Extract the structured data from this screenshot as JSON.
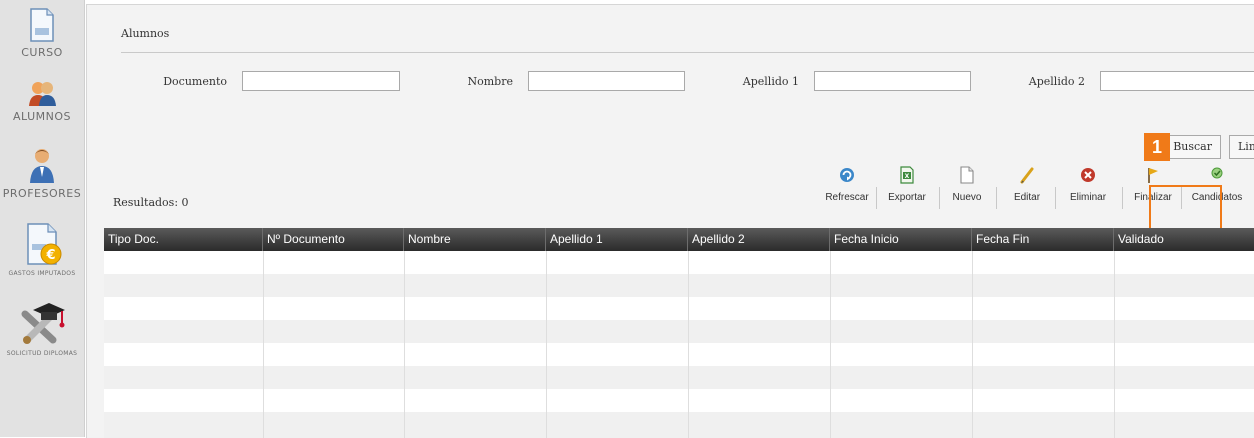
{
  "sidebar": {
    "items": [
      {
        "label": "CURSO",
        "icon": "document-icon"
      },
      {
        "label": "ALUMNOS",
        "icon": "students-icon"
      },
      {
        "label": "PROFESORES",
        "icon": "teacher-icon"
      },
      {
        "label": "GASTOS IMPUTADOS",
        "icon": "euro-document-icon"
      },
      {
        "label": "SOLICITUD DIPLOMAS",
        "icon": "diploma-icon"
      }
    ]
  },
  "section": {
    "title": "Alumnos"
  },
  "filters": {
    "documento": {
      "label": "Documento",
      "value": ""
    },
    "nombre": {
      "label": "Nombre",
      "value": ""
    },
    "apellido1": {
      "label": "Apellido 1",
      "value": ""
    },
    "apellido2": {
      "label": "Apellido 2",
      "value": ""
    }
  },
  "search_buttons": {
    "buscar": "Buscar",
    "limpiar": "Limpiar"
  },
  "step_badge": "1",
  "results": {
    "label": "Resultados: 0"
  },
  "toolbar": {
    "refrescar": "Refrescar",
    "exportar": "Exportar",
    "nuevo": "Nuevo",
    "editar": "Editar",
    "eliminar": "Eliminar",
    "finalizar": "Finalizar",
    "candidatos": "Candidatos"
  },
  "grid": {
    "columns": [
      "Tipo Doc.",
      "Nº Documento",
      "Nombre",
      "Apellido 1",
      "Apellido 2",
      "Fecha Inicio",
      "Fecha Fin",
      "Validado"
    ],
    "rows": []
  },
  "colors": {
    "highlight": "#f07a18",
    "header_dark": "#2b2b2b",
    "sidebar_bg": "#e2e2e2",
    "panel_bg": "#f3f3f3"
  }
}
